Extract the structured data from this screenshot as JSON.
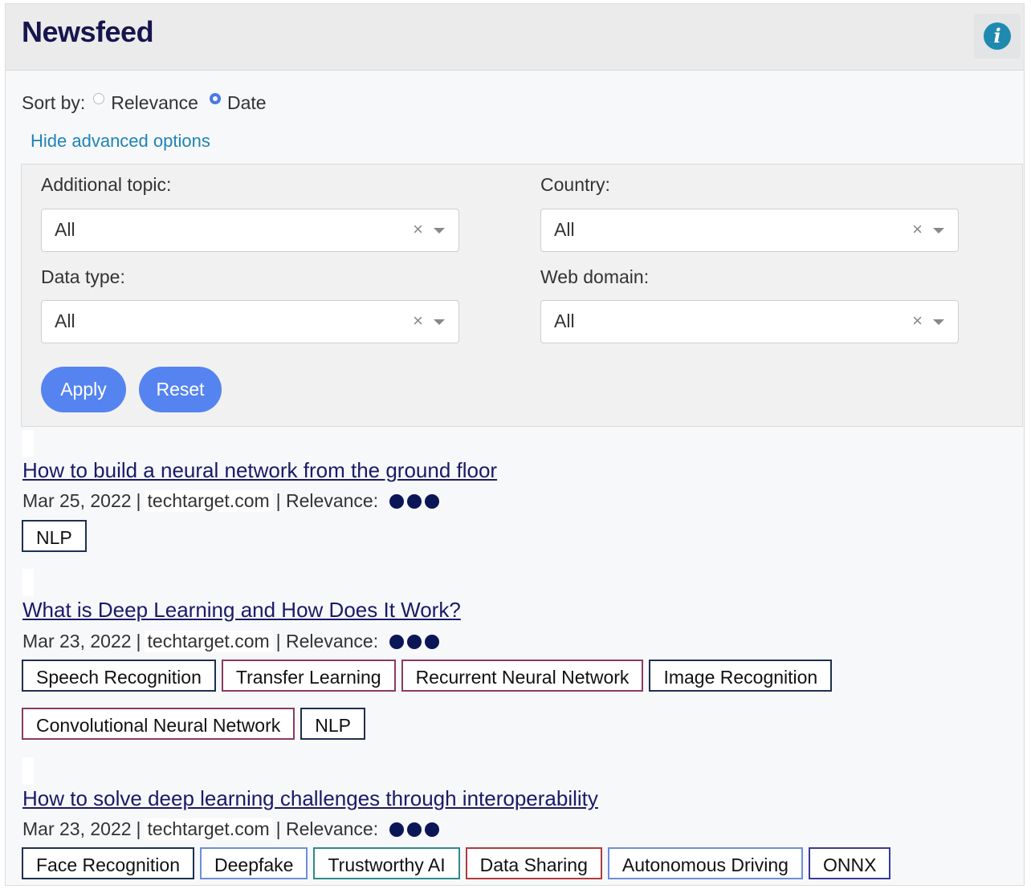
{
  "header": {
    "title": "Newsfeed",
    "info_icon": "info-icon"
  },
  "sort": {
    "label": "Sort by:",
    "options": [
      "Relevance",
      "Date"
    ],
    "selected": "Date"
  },
  "advanced_link": "Hide advanced options",
  "filters": {
    "additional_topic": {
      "label": "Additional topic:",
      "value": "All"
    },
    "country": {
      "label": "Country:",
      "value": "All"
    },
    "data_type": {
      "label": "Data type:",
      "value": "All"
    },
    "web_domain": {
      "label": "Web domain:",
      "value": "All"
    },
    "clear_symbol": "×"
  },
  "buttons": {
    "apply": "Apply",
    "reset": "Reset"
  },
  "relevance_label": "| Relevance:",
  "articles": [
    {
      "title": "How to build a neural network from the ground floor",
      "date": "Mar 25, 2022",
      "domain": "techtarget.com",
      "relevance": 3,
      "tags": [
        {
          "label": "NLP",
          "color": "#1e3050"
        }
      ]
    },
    {
      "title": "What is Deep Learning and How Does It Work?",
      "date": "Mar 23, 2022",
      "domain": "techtarget.com",
      "relevance": 3,
      "tags": [
        {
          "label": "Speech Recognition",
          "color": "#1e3050"
        },
        {
          "label": "Transfer Learning",
          "color": "#8b3a5e"
        },
        {
          "label": "Recurrent Neural Network",
          "color": "#8b3a5e"
        },
        {
          "label": "Image Recognition",
          "color": "#1e3050"
        },
        {
          "label": "Convolutional Neural Network",
          "color": "#8b3a5e"
        },
        {
          "label": "NLP",
          "color": "#1e3050"
        }
      ]
    },
    {
      "title": "How to solve deep learning challenges through interoperability",
      "date": "Mar 23, 2022",
      "domain": "techtarget.com",
      "relevance": 3,
      "tags": [
        {
          "label": "Face Recognition",
          "color": "#1e3050"
        },
        {
          "label": "Deepfake",
          "color": "#6b8fd8"
        },
        {
          "label": "Trustworthy AI",
          "color": "#2e8a8a"
        },
        {
          "label": "Data Sharing",
          "color": "#b23a3a"
        },
        {
          "label": "Autonomous Driving",
          "color": "#6b8fd8"
        },
        {
          "label": "ONNX",
          "color": "#3a3a9a"
        }
      ]
    }
  ],
  "colors": {
    "accent": "#5584f0",
    "title": "#16164e",
    "link": "#1e84b5",
    "relevance_dot": "#0b1657"
  }
}
